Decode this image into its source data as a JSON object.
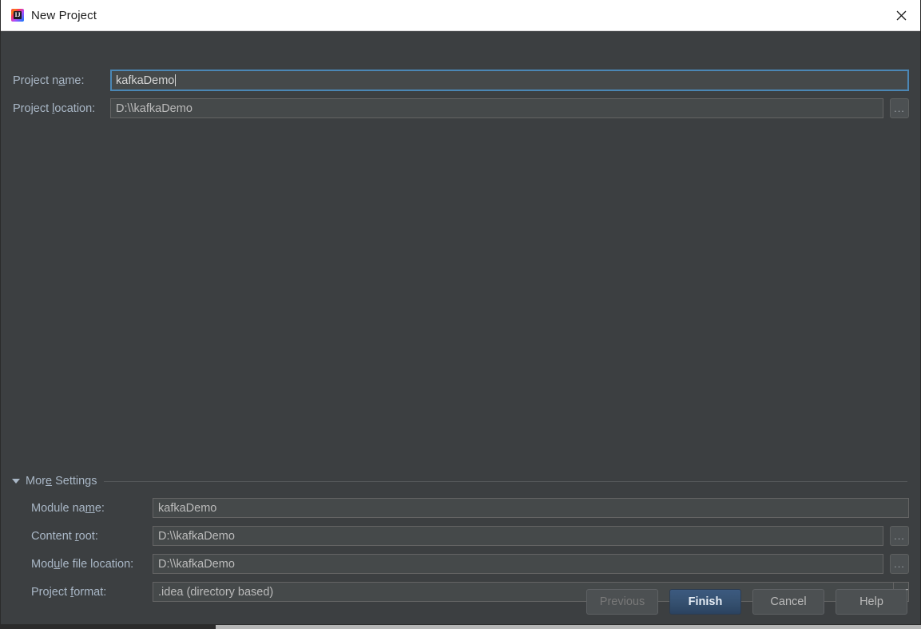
{
  "window": {
    "title": "New Project",
    "app_icon": "intellij-idea-icon",
    "close_icon": "close-icon"
  },
  "form": {
    "project_name": {
      "label_pre": "Project n",
      "label_mnemonic": "a",
      "label_post": "me:",
      "value": "kafkaDemo",
      "focused": true
    },
    "project_location": {
      "label_pre": "Project ",
      "label_mnemonic": "l",
      "label_post": "ocation:",
      "value": "D:\\\\kafkaDemo",
      "browse_label": "...",
      "browse_icon": "ellipsis-icon"
    }
  },
  "more_settings": {
    "toggle_icon": "triangle-down-icon",
    "label_pre": "Mor",
    "label_mnemonic": "e",
    "label_post": " Settings",
    "expanded": true,
    "module_name": {
      "label_pre": "Module na",
      "label_mnemonic": "m",
      "label_post": "e:",
      "value": "kafkaDemo"
    },
    "content_root": {
      "label_pre": "Content ",
      "label_mnemonic": "r",
      "label_post": "oot:",
      "value": "D:\\\\kafkaDemo",
      "browse_label": "...",
      "browse_icon": "ellipsis-icon"
    },
    "module_file_location": {
      "label_pre": "Mod",
      "label_mnemonic": "u",
      "label_post": "le file location:",
      "value": "D:\\\\kafkaDemo",
      "browse_label": "...",
      "browse_icon": "ellipsis-icon"
    },
    "project_format": {
      "label_pre": "Project ",
      "label_mnemonic": "f",
      "label_post": "ormat:",
      "value": ".idea (directory based)",
      "dropdown_icon": "chevron-down-icon",
      "options": [
        ".idea (directory based)"
      ]
    }
  },
  "footer": {
    "previous_label": "Previous",
    "previous_disabled": true,
    "finish_label": "Finish",
    "finish_is_default": true,
    "cancel_label": "Cancel",
    "help_label": "Help"
  },
  "colors": {
    "dialog_background": "#3c3f41",
    "titlebar_background": "#ffffff",
    "label_text": "#a9b7c6",
    "field_background": "#45494a",
    "focus_border": "#4b87b5",
    "default_button": "#35506f"
  }
}
